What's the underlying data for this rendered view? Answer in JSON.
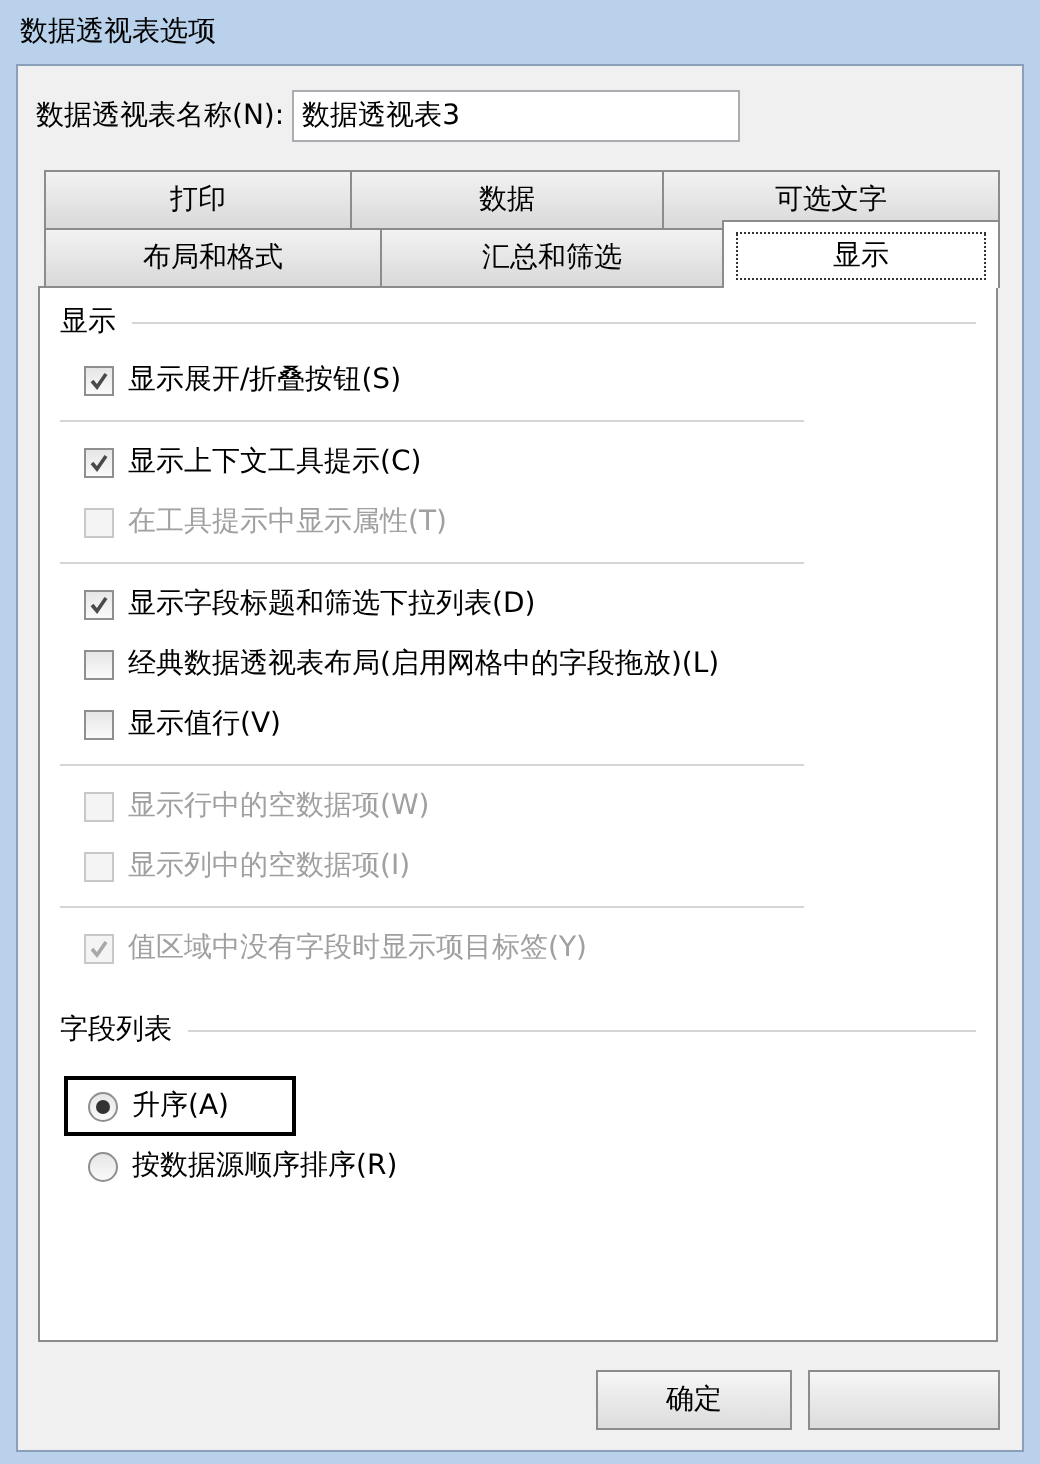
{
  "window": {
    "title": "数据透视表选项"
  },
  "name_field": {
    "label": "数据透视表名称(N):",
    "value": "数据透视表3"
  },
  "tab_rows": [
    [
      {
        "label": "打印",
        "selected": false
      },
      {
        "label": "数据",
        "selected": false
      },
      {
        "label": "可选文字",
        "selected": false
      }
    ],
    [
      {
        "label": "布局和格式",
        "selected": false
      },
      {
        "label": "汇总和筛选",
        "selected": false
      },
      {
        "label": "显示",
        "selected": true
      }
    ]
  ],
  "display_section": {
    "title": "显示",
    "groups": [
      [
        {
          "label": "显示展开/折叠按钮(S)",
          "checked": true,
          "disabled": false
        }
      ],
      [
        {
          "label": "显示上下文工具提示(C)",
          "checked": true,
          "disabled": false
        },
        {
          "label": "在工具提示中显示属性(T)",
          "checked": false,
          "disabled": true
        }
      ],
      [
        {
          "label": "显示字段标题和筛选下拉列表(D)",
          "checked": true,
          "disabled": false
        },
        {
          "label": "经典数据透视表布局(启用网格中的字段拖放)(L)",
          "checked": false,
          "disabled": false
        },
        {
          "label": "显示值行(V)",
          "checked": false,
          "disabled": false
        }
      ],
      [
        {
          "label": "显示行中的空数据项(W)",
          "checked": false,
          "disabled": true
        },
        {
          "label": "显示列中的空数据项(I)",
          "checked": false,
          "disabled": true
        }
      ],
      [
        {
          "label": "值区域中没有字段时显示项目标签(Y)",
          "checked": true,
          "disabled": true
        }
      ]
    ]
  },
  "field_list_section": {
    "title": "字段列表",
    "options": [
      {
        "label": "升序(A)",
        "selected": true,
        "highlighted": true
      },
      {
        "label": "按数据源顺序排序(R)",
        "selected": false,
        "highlighted": false
      }
    ]
  },
  "buttons": [
    "确定"
  ]
}
